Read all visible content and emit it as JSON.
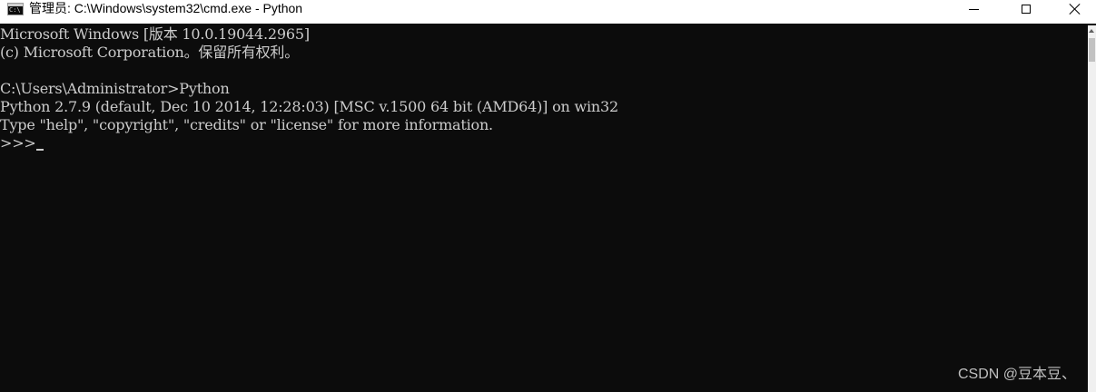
{
  "window": {
    "title": "管理员: C:\\Windows\\system32\\cmd.exe - Python",
    "icon": "cmd-console-icon",
    "icon_text": "C:\\",
    "controls": {
      "minimize": "minimize-icon",
      "maximize": "maximize-icon",
      "close": "close-icon"
    }
  },
  "console": {
    "background": "#0c0c0c",
    "foreground": "#cccccc",
    "lines": [
      "Microsoft Windows [版本 10.0.19044.2965]",
      "(c) Microsoft Corporation。保留所有权利。",
      "",
      "C:\\Users\\Administrator>Python",
      "Python 2.7.9 (default, Dec 10 2014, 12:28:03) [MSC v.1500 64 bit (AMD64)] on win32",
      "Type \"help\", \"copyright\", \"credits\" or \"license\" for more information."
    ],
    "prompt": ">>>"
  },
  "watermark": "CSDN @豆本豆、"
}
